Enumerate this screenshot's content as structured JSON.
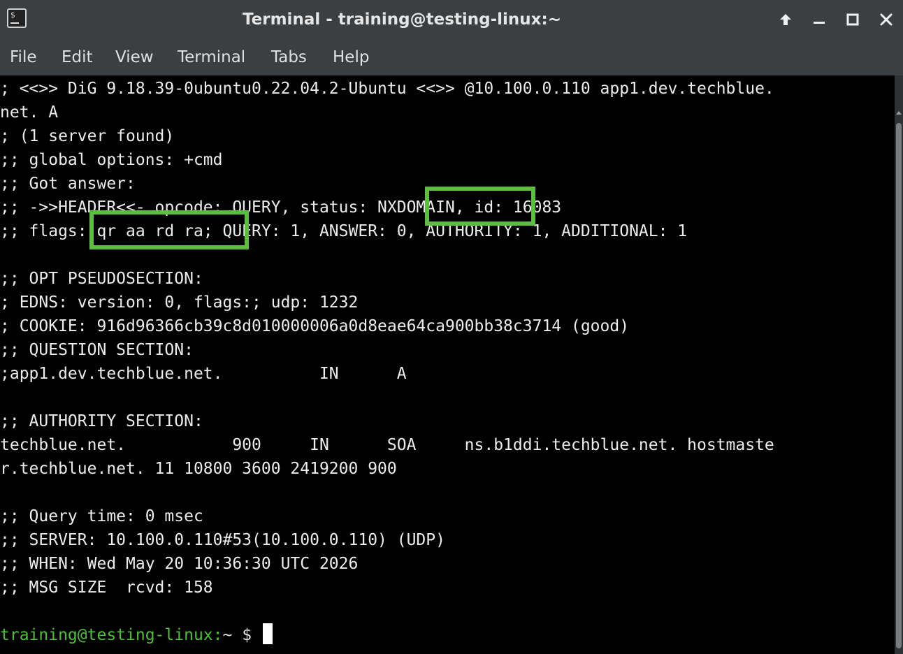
{
  "window": {
    "title": "Terminal - training@testing-linux:~",
    "app_icon_text": "$_"
  },
  "menu": [
    "File",
    "Edit",
    "View",
    "Terminal",
    "Tabs",
    "Help"
  ],
  "terminal": {
    "lines": [
      "; <<>> DiG 9.18.39-0ubuntu0.22.04.2-Ubuntu <<>> @10.100.0.110 app1.dev.techblue.",
      "net. A",
      "; (1 server found)",
      ";; global options: +cmd",
      ";; Got answer:",
      ";; ->>HEADER<<- opcode: QUERY, status: NXDOMAIN, id: 16083",
      ";; flags: qr aa rd ra; QUERY: 1, ANSWER: 0, AUTHORITY: 1, ADDITIONAL: 1",
      "",
      ";; OPT PSEUDOSECTION:",
      "; EDNS: version: 0, flags:; udp: 1232",
      "; COOKIE: 916d96366cb39c8d010000006a0d8eae64ca900bb38c3714 (good)",
      ";; QUESTION SECTION:",
      ";app1.dev.techblue.net.          IN      A",
      "",
      ";; AUTHORITY SECTION:",
      "techblue.net.           900     IN      SOA     ns.b1ddi.techblue.net. hostmaste",
      "r.techblue.net. 11 10800 3600 2419200 900",
      "",
      ";; Query time: 0 msec",
      ";; SERVER: 10.100.0.110#53(10.100.0.110) (UDP)",
      ";; WHEN: Wed May 20 10:36:30 UTC 2026",
      ";; MSG SIZE  rcvd: 158",
      ""
    ],
    "prompt_user": "training@testing-linux:",
    "prompt_path": "~ $ "
  },
  "annotations": [
    {
      "label": "status NXDOMAIN highlight"
    },
    {
      "label": "flags qr aa rd ra highlight"
    }
  ],
  "colors": {
    "titlebar_bg": "#3c3f42",
    "terminal_bg": "#000000",
    "terminal_fg": "#ececec",
    "prompt_green": "#4fbf3a",
    "highlight_green": "#5cbe3c"
  }
}
